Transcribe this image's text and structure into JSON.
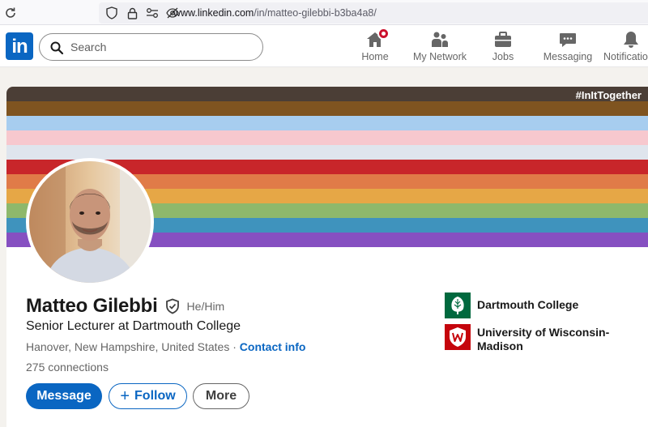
{
  "browser": {
    "url_host": "www.linkedin.com",
    "url_path": "/in/matteo-gilebbi-b3ba4a8/"
  },
  "header": {
    "logo_text": "in",
    "search": {
      "placeholder": "Search",
      "value": ""
    },
    "nav": [
      {
        "label": "Home",
        "icon": "home-icon",
        "has_badge": true
      },
      {
        "label": "My Network",
        "icon": "network-icon"
      },
      {
        "label": "Jobs",
        "icon": "briefcase-icon"
      },
      {
        "label": "Messaging",
        "icon": "messaging-icon"
      },
      {
        "label": "Notifications",
        "icon": "bell-icon"
      }
    ]
  },
  "banner": {
    "hashtag": "#InItTogether",
    "stripes": [
      "#4b3e36",
      "#7f5420",
      "#a7cdef",
      "#f7c8ce",
      "#dfe5ed",
      "#c8262a",
      "#e07b48",
      "#e6a746",
      "#8eb86b",
      "#3f93bd",
      "#8650c1"
    ]
  },
  "profile": {
    "name": "Matteo Gilebbi",
    "pronouns": "He/Him",
    "headline": "Senior Lecturer at Dartmouth College",
    "location": "Hanover, New Hampshire, United States",
    "location_sep": " · ",
    "contact_info": "Contact info",
    "connections": "275 connections",
    "actions": {
      "message": "Message",
      "follow": "Follow",
      "more": "More"
    },
    "education": [
      {
        "name": "Dartmouth College",
        "logo": "dartmouth-logo",
        "color": "#00693e"
      },
      {
        "name": "University of Wisconsin-Madison",
        "logo": "uw-madison-logo",
        "color": "#c5050c"
      }
    ]
  },
  "colors": {
    "brand": "#0a66c2",
    "badge": "#cb112d"
  }
}
